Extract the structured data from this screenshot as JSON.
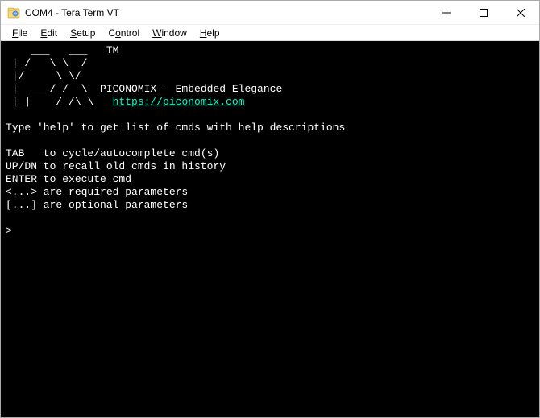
{
  "window": {
    "title": "COM4 - Tera Term VT"
  },
  "menu": {
    "file": "File",
    "edit": "Edit",
    "setup": "Setup",
    "control": "Control",
    "window": "Window",
    "help": "Help"
  },
  "terminal": {
    "ascii_l1": "    ___   ___   TM",
    "ascii_l2": " | /   \\ \\  /",
    "ascii_l3": " |/     \\ \\/",
    "ascii_l4": " |  ___/ /  \\  PICONOMIX - Embedded Elegance",
    "ascii_l5_prefix": " |_|    /_/\\_\\   ",
    "url": "https://piconomix.com",
    "blank": "",
    "help_hint": "Type 'help' to get list of cmds with help descriptions",
    "usage_tab": "TAB   to cycle/autocomplete cmd(s)",
    "usage_updn": "UP/DN to recall old cmds in history",
    "usage_enter": "ENTER to execute cmd",
    "usage_req": "<...> are required parameters",
    "usage_opt": "[...] are optional parameters",
    "prompt": ">"
  }
}
